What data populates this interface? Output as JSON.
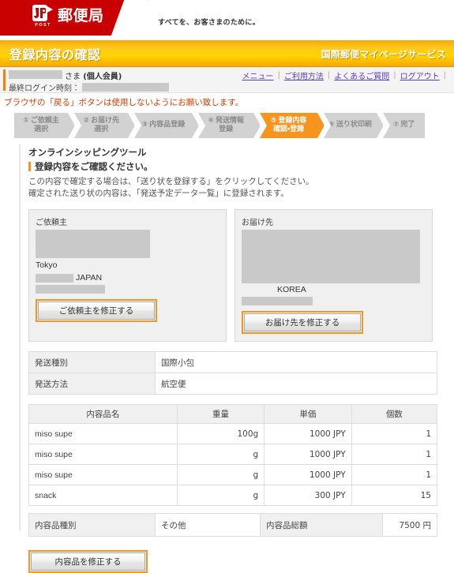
{
  "brand": {
    "logo_mark": "jp-post-logo",
    "logo_sub": "POST",
    "name": "郵便局",
    "tagline": "すべてを、お客さまのために。"
  },
  "title_bar": {
    "page_title": "登録内容の確認",
    "service_name": "国際郵便マイページサービス"
  },
  "user_bar": {
    "name_suffix": "さま",
    "member_type": "(個人会員)",
    "last_login_label": "最終ログイン時刻：",
    "links": [
      {
        "label": "メニュー"
      },
      {
        "label": "ご利用方法"
      },
      {
        "label": "よくあるご質問"
      },
      {
        "label": "ログアウト"
      }
    ]
  },
  "warning": "ブラウザの「戻る」ボタンは使用しないようにお願い致します。",
  "steps": [
    {
      "num": "①",
      "line1": "ご依頼主",
      "line2": "選択",
      "active": false
    },
    {
      "num": "②",
      "line1": "お届け先",
      "line2": "選択",
      "active": false
    },
    {
      "num": "③",
      "line1": "内容品登録",
      "line2": "",
      "active": false
    },
    {
      "num": "④",
      "line1": "発送情報",
      "line2": "登録",
      "active": false
    },
    {
      "num": "⑤",
      "line1": "登録内容",
      "line2": "確認・登録",
      "active": true
    },
    {
      "num": "⑥",
      "line1": "送り状印刷",
      "line2": "",
      "active": false
    },
    {
      "num": "⑦",
      "line1": "完了",
      "line2": "",
      "active": false
    }
  ],
  "main": {
    "tool_title": "オンラインシッピングツール",
    "sub_title": "登録内容をご確認ください。",
    "desc_line1": "この内容で確定する場合は、「送り状を登録する」をクリックしてください。",
    "desc_line2": "確定された送り状の内容は、「発送予定データ一覧」に登録されます。"
  },
  "sender": {
    "label": "ご依頼主",
    "city": "Tokyo",
    "country": "JAPAN",
    "edit_button": "ご依頼主を修正する"
  },
  "recipient": {
    "label": "お届け先",
    "country": "KOREA",
    "edit_button": "お届け先を修正する"
  },
  "shipping_info": {
    "rows": [
      {
        "label": "発送種別",
        "value": "国際小包"
      },
      {
        "label": "発送方法",
        "value": "航空便"
      }
    ]
  },
  "items_table": {
    "headers": [
      "内容品名",
      "重量",
      "単価",
      "個数"
    ],
    "rows": [
      {
        "name": "miso supe",
        "weight": "100g",
        "price": "1000 JPY",
        "qty": "1"
      },
      {
        "name": "miso supe",
        "weight": "g",
        "price": "1000 JPY",
        "qty": "1"
      },
      {
        "name": "miso supe",
        "weight": "g",
        "price": "1000 JPY",
        "qty": "1"
      },
      {
        "name": "snack",
        "weight": "g",
        "price": "300 JPY",
        "qty": "15"
      }
    ]
  },
  "summary": {
    "category_label": "内容品種別",
    "category_value": "その他",
    "total_label": "内容品総額",
    "total_value": "7500 円"
  },
  "items_edit_button": "内容品を修正する",
  "colors": {
    "brand_red": "#c80000",
    "accent_orange": "#f7941d",
    "title_gradient_top": "#f5a800",
    "title_gradient_mid": "#ffd400",
    "link_purple": "#5a3ec8",
    "warning_red": "#d93b00",
    "step_inactive": "#d2d2d2",
    "redaction_gray": "#c9c9c9"
  }
}
